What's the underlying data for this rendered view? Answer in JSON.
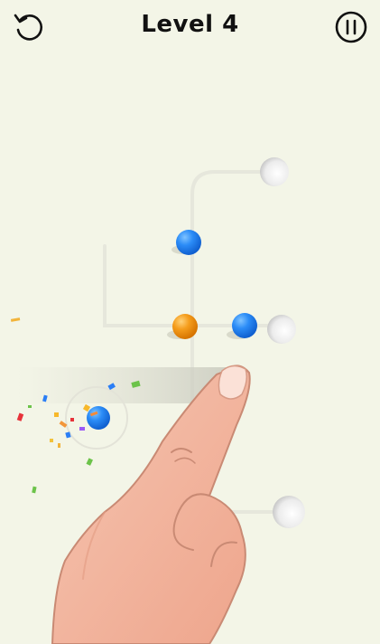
{
  "header": {
    "level_title": "Level 4",
    "restart_icon": "restart-icon",
    "pause_icon": "pause-icon"
  },
  "board": {
    "colors": {
      "background": "#f3f5e7",
      "path": "#e7e8dc",
      "hole": "#e9e9e9",
      "blue_ball": "#1e7ff2",
      "orange_ball": "#f29a1b",
      "skin": "#f2b7a0"
    },
    "balls": [
      {
        "color": "blue"
      },
      {
        "color": "orange"
      },
      {
        "color": "blue"
      },
      {
        "color": "blue"
      }
    ],
    "holes": 3
  }
}
